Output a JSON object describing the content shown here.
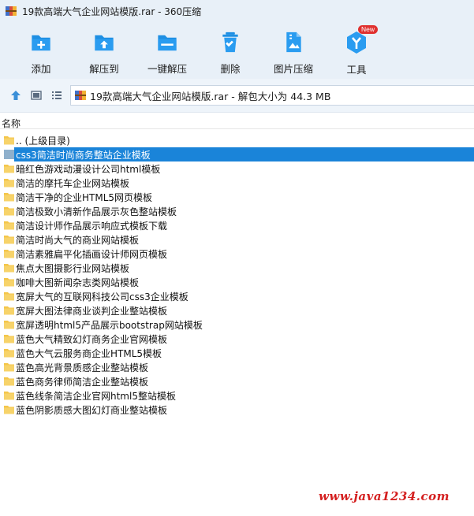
{
  "window": {
    "title": "19款高端大气企业网站模版.rar - 360压缩",
    "app_icon": "archive-rar-icon"
  },
  "toolbar": {
    "items": [
      {
        "label": "添加",
        "icon": "add-icon"
      },
      {
        "label": "解压到",
        "icon": "extract-to-icon"
      },
      {
        "label": "一键解压",
        "icon": "one-click-extract-icon"
      },
      {
        "label": "删除",
        "icon": "delete-icon"
      },
      {
        "label": "图片压缩",
        "icon": "image-compress-icon"
      },
      {
        "label": "工具",
        "icon": "tools-icon",
        "badge": "New"
      }
    ],
    "accent": "#1e8fe3"
  },
  "navbar": {
    "address": "19款高端大气企业网站模版.rar - 解包大小为 44.3 MB",
    "buttons": [
      "up-icon",
      "thumbnail-view-icon",
      "list-view-icon"
    ]
  },
  "list": {
    "column_header": "名称",
    "items": [
      {
        "name": ".. (上级目录)",
        "type": "parent"
      },
      {
        "name": "css3简洁时尚商务整站企业模板",
        "type": "folder",
        "selected": true
      },
      {
        "name": "暗红色游戏动漫设计公司html模板",
        "type": "folder"
      },
      {
        "name": "简洁的摩托车企业网站模板",
        "type": "folder"
      },
      {
        "name": "简洁干净的企业HTML5网页模板",
        "type": "folder"
      },
      {
        "name": "简洁极致小清新作品展示灰色整站模板",
        "type": "folder"
      },
      {
        "name": "简洁设计师作品展示响应式模板下载",
        "type": "folder"
      },
      {
        "name": "简洁时尚大气的商业网站模板",
        "type": "folder"
      },
      {
        "name": "简洁素雅扁平化插画设计师网页模板",
        "type": "folder"
      },
      {
        "name": "焦点大图摄影行业网站模板",
        "type": "folder"
      },
      {
        "name": "咖啡大图新闻杂志类网站模板",
        "type": "folder"
      },
      {
        "name": "宽屏大气的互联网科技公司css3企业模板",
        "type": "folder"
      },
      {
        "name": "宽屏大图法律商业谈判企业整站模板",
        "type": "folder"
      },
      {
        "name": "宽屏透明html5产品展示bootstrap网站模板",
        "type": "folder"
      },
      {
        "name": "蓝色大气精致幻灯商务企业官网模板",
        "type": "folder"
      },
      {
        "name": "蓝色大气云服务商企业HTML5模板",
        "type": "folder"
      },
      {
        "name": "蓝色高光背景质感企业整站模板",
        "type": "folder"
      },
      {
        "name": "蓝色商务律师简洁企业整站模板",
        "type": "folder"
      },
      {
        "name": "蓝色线条简洁企业官网html5整站模板",
        "type": "folder"
      },
      {
        "name": "蓝色阴影质感大图幻灯商业整站模板",
        "type": "folder"
      }
    ],
    "selection_color": "#1a84d9",
    "folder_color": "#f4c64a"
  },
  "watermark": {
    "text": "www.java1234.com",
    "color": "#d41f1f"
  }
}
